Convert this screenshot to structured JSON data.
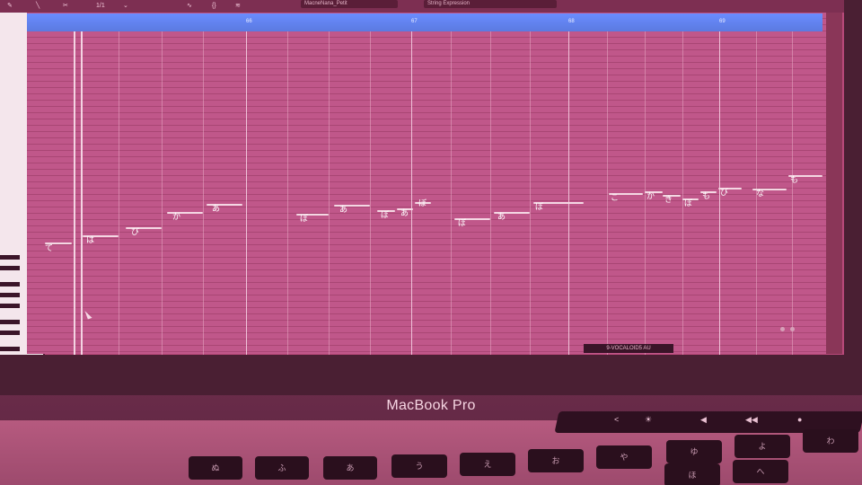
{
  "toolbar": {
    "counter": "1/1",
    "track_name": "MacneNana_Petit",
    "expression": "String Expression"
  },
  "timeline": {
    "bars": [
      "66",
      "67",
      "68",
      "69"
    ]
  },
  "lyrics": [
    "て",
    "は",
    "び",
    "か",
    "あ",
    "ぼ",
    "あ",
    "ぼ",
    "あ",
    "ぼ",
    "ぼ",
    "あ",
    "ぼ",
    "こ",
    "か",
    "き",
    "ぼ",
    "も",
    "び",
    "な",
    "も"
  ],
  "status": {
    "track": "9-VOCALOID5 AU"
  },
  "laptop": {
    "brand": "MacBook Pro",
    "touchbar": [
      "<",
      "☀︎",
      "◀︎",
      "◀︎◀︎",
      "●"
    ]
  },
  "keyboard": {
    "row1": [
      "ぬ",
      "ふ",
      "あ",
      "う",
      "え",
      "お",
      "や",
      "ゆ",
      "よ",
      "わ",
      "ほ",
      "へ"
    ]
  },
  "colors": {
    "timeline": "#6a8cff",
    "roll": "#c0578a",
    "bezel": "#4a1f33"
  }
}
